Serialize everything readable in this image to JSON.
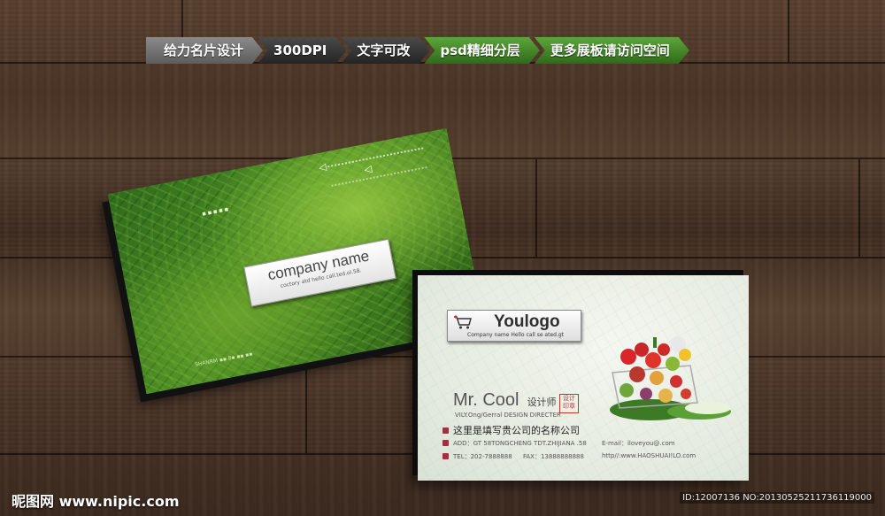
{
  "banner": {
    "items": [
      "给力名片设计",
      "300DPI",
      "文字可改",
      "psd精细分层",
      "更多展板请访问空间"
    ]
  },
  "back_card": {
    "company_name": "company name",
    "company_sub": "coctory atd hello call.ted.ol.58.",
    "pixel_mark": "▪▪▪▪▪",
    "bottom_text": "SHANRM ▪▪ 8▪ ▪▪ ▪▪"
  },
  "front_card": {
    "logo_text": "Youlogo",
    "logo_sub": "Company name Hello call se ated.gt",
    "person_name": "Mr. Cool",
    "person_role": "设计师",
    "person_title": "VILY.Ong/Gerral DESIGN DIRECTER",
    "seal_text": "设计印章",
    "company_cn": "这里是填写贵公司的名称公司",
    "address": "ADD：GT 58TONGCHENG TDT.ZHIJIANA .58",
    "tel": "TEL：202-7888888",
    "fax": "FAX：13888888888",
    "email": "E-mail：iloveyou@.com",
    "web": "http//:www.HAOSHUAI!LO.com"
  },
  "watermark": {
    "left": "昵图网 www.nipic.com",
    "right": "ID:12007136 NO:20130525211736119000"
  },
  "colors": {
    "accent_green": "#3f8a22",
    "banner_gray": "#6f6f6f",
    "banner_dark": "#2e2e2e",
    "check_red": "#a23040"
  }
}
